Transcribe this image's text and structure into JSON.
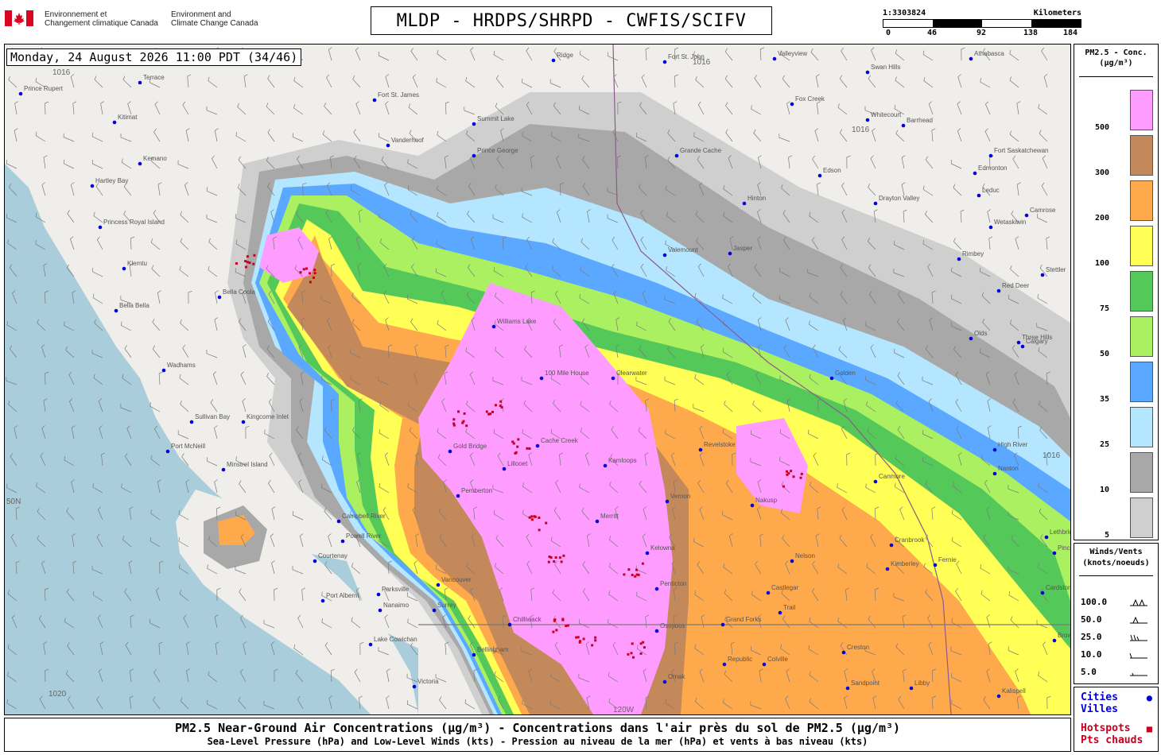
{
  "header": {
    "logo_fr": [
      "Environnement et",
      "Changement climatique Canada"
    ],
    "logo_en": [
      "Environment and",
      "Climate Change Canada"
    ],
    "title": "MLDP - HRDPS/SHRPD - CWFIS/SCIFV",
    "scale": {
      "ratio": "1:3303824",
      "unit": "Kilometers",
      "ticks": [
        "0",
        "46",
        "92",
        "138",
        "184"
      ]
    }
  },
  "timestamp": "Monday, 24 August 2026 11:00 PDT (34/46)",
  "legend": {
    "title": [
      "PM2.5 - Conc.",
      "(µg/m³)"
    ],
    "bins": [
      {
        "label": "500",
        "color": "#ff9cff"
      },
      {
        "label": "300",
        "color": "#c4895a"
      },
      {
        "label": "200",
        "color": "#ffa94d"
      },
      {
        "label": "100",
        "color": "#ffff55"
      },
      {
        "label": "75",
        "color": "#55c85a"
      },
      {
        "label": "50",
        "color": "#aaf060"
      },
      {
        "label": "35",
        "color": "#5aa8ff"
      },
      {
        "label": "25",
        "color": "#b4e6ff"
      },
      {
        "label": "10",
        "color": "#a8a8a8"
      },
      {
        "label": "5",
        "color": "#cfcfcf"
      }
    ]
  },
  "winds": {
    "title": [
      "Winds/Vents",
      "(knots/noeuds)"
    ],
    "rows": [
      "100.0",
      "50.0",
      "25.0",
      "10.0",
      "5.0"
    ]
  },
  "points": {
    "cities": [
      "Cities",
      "Villes"
    ],
    "hotspots": [
      "Hotspots",
      "Pts chauds"
    ],
    "city_color": "#0000e0",
    "hotspot_color": "#c8001e"
  },
  "caption": {
    "line1": "PM2.5 Near-Ground Air Concentrations (µg/m³) - Concentrations dans l'air près du sol de PM2.5 (µg/m³)",
    "line2": "Sea-Level Pressure (hPa) and Low-Level Winds (kts) - Pression au niveau de la mer (hPa) et vents à bas niveau (kts)"
  },
  "map": {
    "isobars": [
      "1016",
      "1016",
      "1016",
      "1016",
      "1020"
    ],
    "graticule": [
      "50N",
      "120W"
    ],
    "cities": [
      "Prince Rupert",
      "Terrace",
      "Kitimat",
      "Kemano",
      "Hartley Bay",
      "Princess Royal Island",
      "Klemtu",
      "Bella Bella",
      "Bella Coola",
      "Wadhams",
      "Sullivan Bay",
      "Port McNeill",
      "Minstrel Island",
      "Kingcome Inlet",
      "Campbell River",
      "Powell River",
      "Courtenay",
      "Port Alberni",
      "Parksville",
      "Nanaimo",
      "Lake Cowichan",
      "Victoria",
      "Vancouver",
      "Surrey",
      "Bellingham",
      "Fort St. James",
      "Summit Lake",
      "Prince George",
      "Vanderhoof",
      "Williams Lake",
      "100 Mile House",
      "Clearwater",
      "Cache Creek",
      "Lillooet",
      "Kamloops",
      "Merritt",
      "Kelowna",
      "Vernon",
      "Penticton",
      "Osoyoos",
      "Grand Forks",
      "Republic",
      "Omak",
      "Gold Bridge",
      "Pemberton",
      "Revelstoke",
      "Nakusp",
      "Nelson",
      "Castlegar",
      "Trail",
      "Colville",
      "Sandpoint",
      "Libby",
      "Kalispell",
      "Cranbrook",
      "Kimberley",
      "Fernie",
      "Jasper",
      "Valemount",
      "Hinton",
      "Edson",
      "Whitecourt",
      "Swan Hills",
      "Fox Creek",
      "Barrhead",
      "Edmonton",
      "Leduc",
      "Wetaskiwin",
      "Red Deer",
      "Olds",
      "Calgary",
      "Drayton Valley",
      "Rimbey",
      "Camrose",
      "Stettler",
      "Three Hills",
      "Lethbridge",
      "Cardston",
      "Valleyview",
      "Grande Cache",
      "Ridge",
      "Athabasca",
      "Fort Saskatchewan",
      "Golden",
      "Canmore",
      "High River",
      "Nanton",
      "Pincher Creek",
      "Creston",
      "Browning",
      "Chilliwack",
      "Fort St. John"
    ]
  }
}
